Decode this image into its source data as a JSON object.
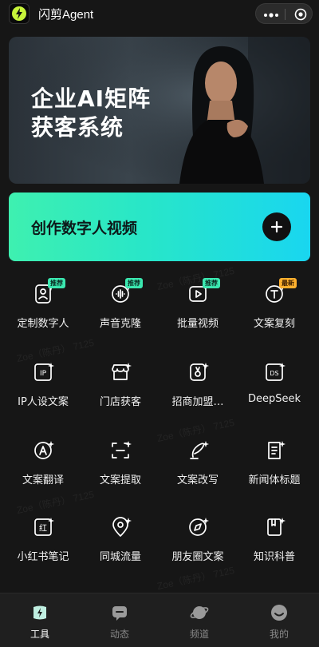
{
  "header": {
    "title": "闪剪Agent",
    "logo_icon": "lightning-logo-icon",
    "more_icon": "more-dots-icon",
    "close_icon": "target-close-icon"
  },
  "banner": {
    "line1": "企业AI矩阵",
    "line2": "获客系统"
  },
  "create": {
    "label": "创作数字人视频",
    "plus_icon": "plus-icon"
  },
  "tools": [
    {
      "label": "定制数字人",
      "icon": "digital-human-icon",
      "badge": "推荐"
    },
    {
      "label": "声音克隆",
      "icon": "voice-clone-icon",
      "badge": "推荐"
    },
    {
      "label": "批量视频",
      "icon": "batch-video-icon",
      "badge": "推荐"
    },
    {
      "label": "文案复刻",
      "icon": "copy-replicate-icon",
      "badge": "最新"
    },
    {
      "label": "IP人设文案",
      "icon": "ip-icon",
      "badge": ""
    },
    {
      "label": "门店获客",
      "icon": "store-icon",
      "badge": ""
    },
    {
      "label": "招商加盟…",
      "icon": "franchise-icon",
      "badge": ""
    },
    {
      "label": "DeepSeek",
      "icon": "deepseek-icon",
      "badge": ""
    },
    {
      "label": "文案翻译",
      "icon": "translate-icon",
      "badge": ""
    },
    {
      "label": "文案提取",
      "icon": "extract-icon",
      "badge": ""
    },
    {
      "label": "文案改写",
      "icon": "rewrite-icon",
      "badge": ""
    },
    {
      "label": "新闻体标题",
      "icon": "news-title-icon",
      "badge": ""
    },
    {
      "label": "小红书笔记",
      "icon": "xiaohongshu-icon",
      "badge": ""
    },
    {
      "label": "同城流量",
      "icon": "location-icon",
      "badge": ""
    },
    {
      "label": "朋友圈文案",
      "icon": "moments-icon",
      "badge": ""
    },
    {
      "label": "知识科普",
      "icon": "knowledge-book-icon",
      "badge": ""
    }
  ],
  "nav": [
    {
      "label": "工具",
      "icon": "tools-icon",
      "active": true
    },
    {
      "label": "动态",
      "icon": "feed-chat-icon",
      "active": false
    },
    {
      "label": "频道",
      "icon": "channel-planet-icon",
      "active": false
    },
    {
      "label": "我的",
      "icon": "profile-face-icon",
      "active": false
    }
  ],
  "watermark": "Zoe（陈丹） 7125",
  "colors": {
    "background": "#161616",
    "accent_start": "#3ef0b0",
    "accent_end": "#19d6f0"
  }
}
